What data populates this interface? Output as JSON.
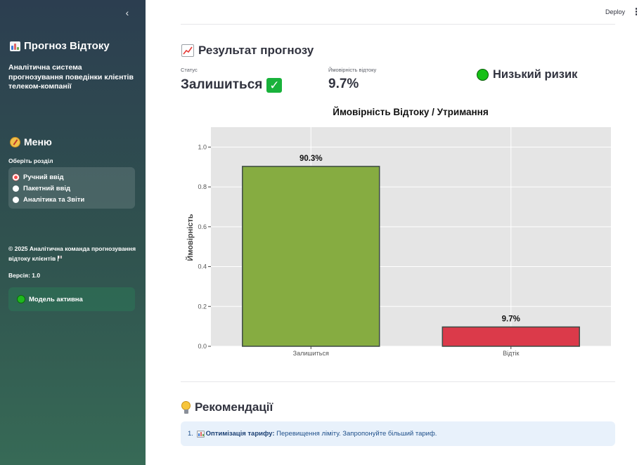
{
  "sidebar": {
    "collapse_glyph": "‹",
    "app_title": "Прогноз Відтоку",
    "description": "Аналітична система прогнозування поведінки клієнтів телеком-компанії",
    "menu_title": "Меню",
    "section_label": "Оберіть розділ",
    "menu_items": [
      {
        "label": "Ручний ввід",
        "selected": true
      },
      {
        "label": "Пакетний ввід",
        "selected": false
      },
      {
        "label": "Аналітика та Звіти",
        "selected": false
      }
    ],
    "copyright": "© 2025 Аналітична команда прогнозування відтоку клієнтів",
    "version": "Версія: 1.0",
    "model_status": "Модель активна"
  },
  "toolbar": {
    "deploy_label": "Deploy"
  },
  "result": {
    "heading": "Результат прогнозу",
    "status_label": "Статус",
    "status_value": "Залишиться",
    "status_icon": "✓",
    "probability_label": "Ймовірність відтоку",
    "probability_value": "9.7%",
    "risk_label": "Низький ризик"
  },
  "chart_data": {
    "type": "bar",
    "title": "Ймовірність Відтоку / Утримання",
    "xlabel": "",
    "ylabel": "Ймовірність",
    "categories": [
      "Залишиться",
      "Відтік"
    ],
    "values": [
      0.903,
      0.097
    ],
    "data_labels": [
      "90.3%",
      "9.7%"
    ],
    "colors": [
      "#86ac41",
      "#db3a4a"
    ],
    "ylim": [
      0,
      1.1
    ],
    "yticks": [
      0.0,
      0.2,
      0.4,
      0.6,
      0.8,
      1.0
    ],
    "ytick_labels": [
      "0.0",
      "0.2",
      "0.4",
      "0.6",
      "0.8",
      "1.0"
    ],
    "grid": true,
    "background": "#e5e5e5"
  },
  "recommendations": {
    "heading": "Рекомендації",
    "items": [
      {
        "number": "1.",
        "title": "Оптимізація тарифу:",
        "text": "Перевищення ліміту. Запропонуйте більший тариф."
      }
    ]
  }
}
